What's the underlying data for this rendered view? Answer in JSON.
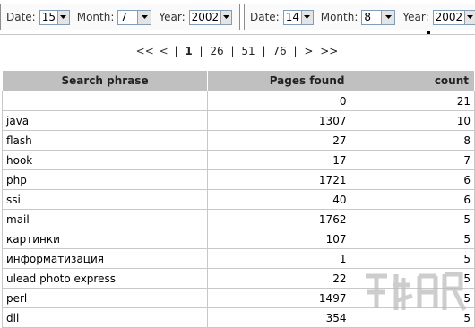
{
  "filters": [
    {
      "date_label": "Date:",
      "date_value": "15",
      "month_label": "Month:",
      "month_value": "7",
      "year_label": "Year:",
      "year_value": "2002"
    },
    {
      "date_label": "Date:",
      "date_value": "14",
      "month_label": "Month:",
      "month_value": "8",
      "year_label": "Year:",
      "year_value": "2002"
    }
  ],
  "pager": {
    "first": "<<",
    "prev": "<",
    "current": "1",
    "separator": "|",
    "pages": [
      "26",
      "51",
      "76"
    ],
    "next": ">",
    "last": ">>"
  },
  "table": {
    "headers": [
      "Search phrase",
      "Pages found",
      "count"
    ],
    "rows": [
      {
        "phrase": "",
        "pages": "0",
        "count": "21"
      },
      {
        "phrase": "java",
        "pages": "1307",
        "count": "10"
      },
      {
        "phrase": "flash",
        "pages": "27",
        "count": "8"
      },
      {
        "phrase": "hook",
        "pages": "17",
        "count": "7"
      },
      {
        "phrase": "php",
        "pages": "1721",
        "count": "6"
      },
      {
        "phrase": "ssi",
        "pages": "40",
        "count": "6"
      },
      {
        "phrase": "mail",
        "pages": "1762",
        "count": "5"
      },
      {
        "phrase": "картинки",
        "pages": "107",
        "count": "5"
      },
      {
        "phrase": "информатизация",
        "pages": "1",
        "count": "5"
      },
      {
        "phrase": "ulead photo express",
        "pages": "22",
        "count": "5"
      },
      {
        "phrase": "perl",
        "pages": "1497",
        "count": "5"
      },
      {
        "phrase": "dll",
        "pages": "354",
        "count": "5"
      }
    ]
  },
  "colors": {
    "header_bg": "#c0c0c0",
    "grid": "#c8c8c8"
  }
}
